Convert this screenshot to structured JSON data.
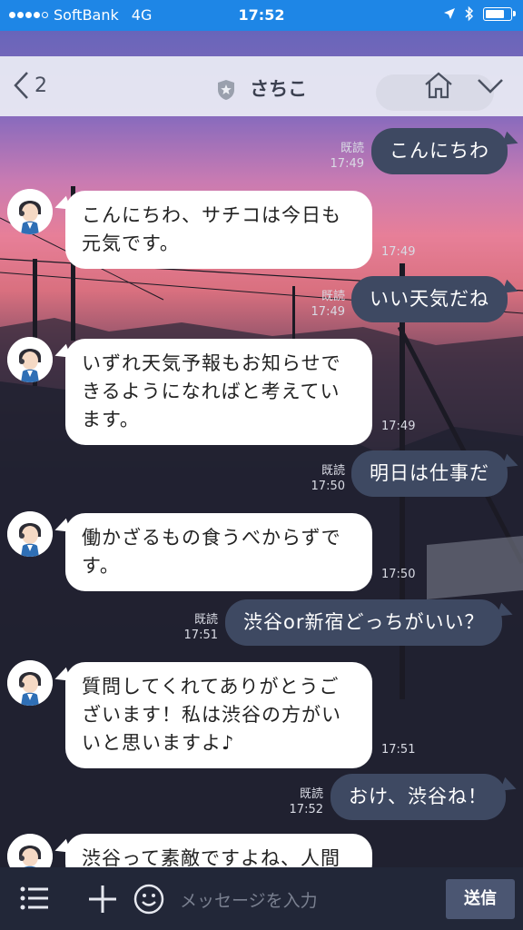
{
  "status_bar": {
    "carrier": "SoftBank",
    "network": "4G",
    "time": "17:52",
    "battery_level": 0.85,
    "signal_bars_filled": 4,
    "signal_bars_total": 5
  },
  "header": {
    "back_count": "2",
    "chat_name": "さちこ"
  },
  "messages": [
    {
      "side": "out",
      "text": "こんにちわ",
      "read": "既読",
      "time": "17:49"
    },
    {
      "side": "in",
      "lines": [
        "こんにちわ、サチコは今日も",
        "元気です。"
      ],
      "time": "17:49"
    },
    {
      "side": "out",
      "text": "いい天気だね",
      "read": "既読",
      "time": "17:49"
    },
    {
      "side": "in",
      "lines": [
        "いずれ天気予報もお知らせで",
        "きるようになればと考えてい",
        "ます。"
      ],
      "time": "17:49"
    },
    {
      "side": "out",
      "text": "明日は仕事だ",
      "read": "既読",
      "time": "17:50"
    },
    {
      "side": "in",
      "lines": [
        "働かざるもの食うべからずで",
        "す。"
      ],
      "time": "17:50"
    },
    {
      "side": "out",
      "text": "渋谷or新宿どっちがいい？",
      "read": "既読",
      "time": "17:51"
    },
    {
      "side": "in",
      "lines": [
        "質問してくれてありがとうご",
        "ざいます！私は渋谷の方がい",
        "いと思いますよ♪"
      ],
      "time": "17:51"
    },
    {
      "side": "out",
      "text": "おけ、渋谷ね！",
      "read": "既読",
      "time": "17:52"
    },
    {
      "side": "in",
      "lines": [
        "渋谷って素敵ですよね、人間"
      ],
      "time": ""
    }
  ],
  "input_bar": {
    "placeholder": "メッセージを入力",
    "send_label": "送信"
  },
  "colors": {
    "status_bar": "#1e86e6",
    "out_bubble": "#3e4962",
    "in_bubble": "#ffffff",
    "input_bar": "#222738"
  }
}
